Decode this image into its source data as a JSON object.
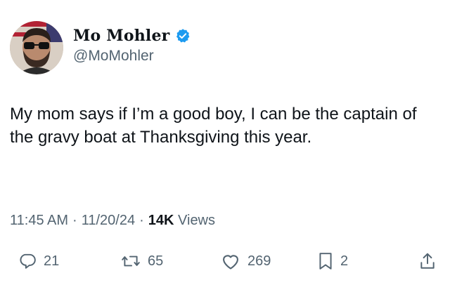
{
  "author": {
    "display_name": "Mo Mohler",
    "handle": "@MoMohler",
    "verified": true,
    "verified_color": "#1d9bf0"
  },
  "tweet": {
    "text": "My mom says if I’m a good boy, I can be the captain of the gravy boat at Thanksgiving this year."
  },
  "meta": {
    "time": "11:45 AM",
    "separator": "·",
    "date": "11/20/24",
    "views_count": "14K",
    "views_label": "Views"
  },
  "actions": {
    "replies": "21",
    "reposts": "65",
    "likes": "269",
    "bookmarks": "2"
  },
  "icons": {
    "reply": "reply-icon",
    "repost": "repost-icon",
    "like": "heart-icon",
    "bookmark": "bookmark-icon",
    "share": "share-icon"
  },
  "colors": {
    "text": "#0f1419",
    "secondary": "#536471",
    "accent": "#1d9bf0"
  }
}
